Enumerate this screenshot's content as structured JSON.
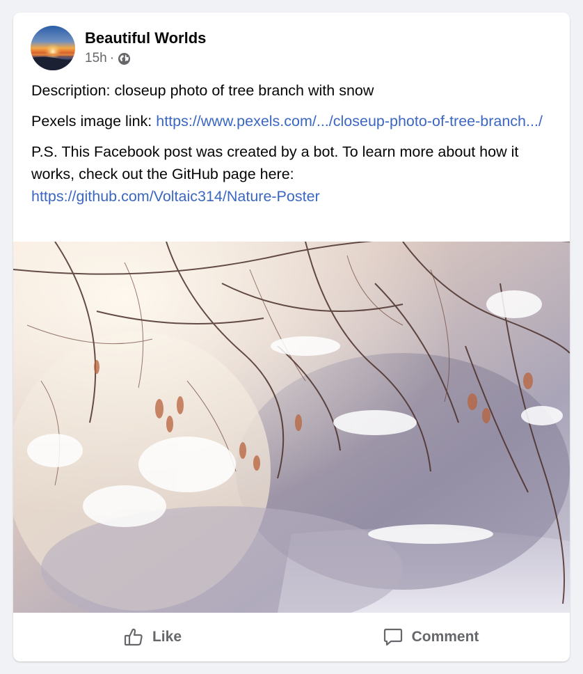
{
  "post": {
    "page_name": "Beautiful Worlds",
    "timestamp": "15h",
    "separator": "·",
    "privacy_icon": "globe-icon",
    "description": "Description: closeup photo of tree branch with snow",
    "pexels_prefix": "Pexels image link: ",
    "pexels_link": "https://www.pexels.com/.../closeup-photo-of-tree-branch.../",
    "ps_text": "P.S. This Facebook post was created by a bot. To learn more about how it works, check out the GitHub page here:",
    "github_link": "https://github.com/Voltaic314/Nature-Poster"
  },
  "actions": {
    "like_label": "Like",
    "like_icon": "thumbs-up-icon",
    "comment_label": "Comment",
    "comment_icon": "comment-bubble-icon"
  },
  "colors": {
    "link": "#3b67c2",
    "secondary_text": "#65676b",
    "background": "#f0f2f5"
  }
}
